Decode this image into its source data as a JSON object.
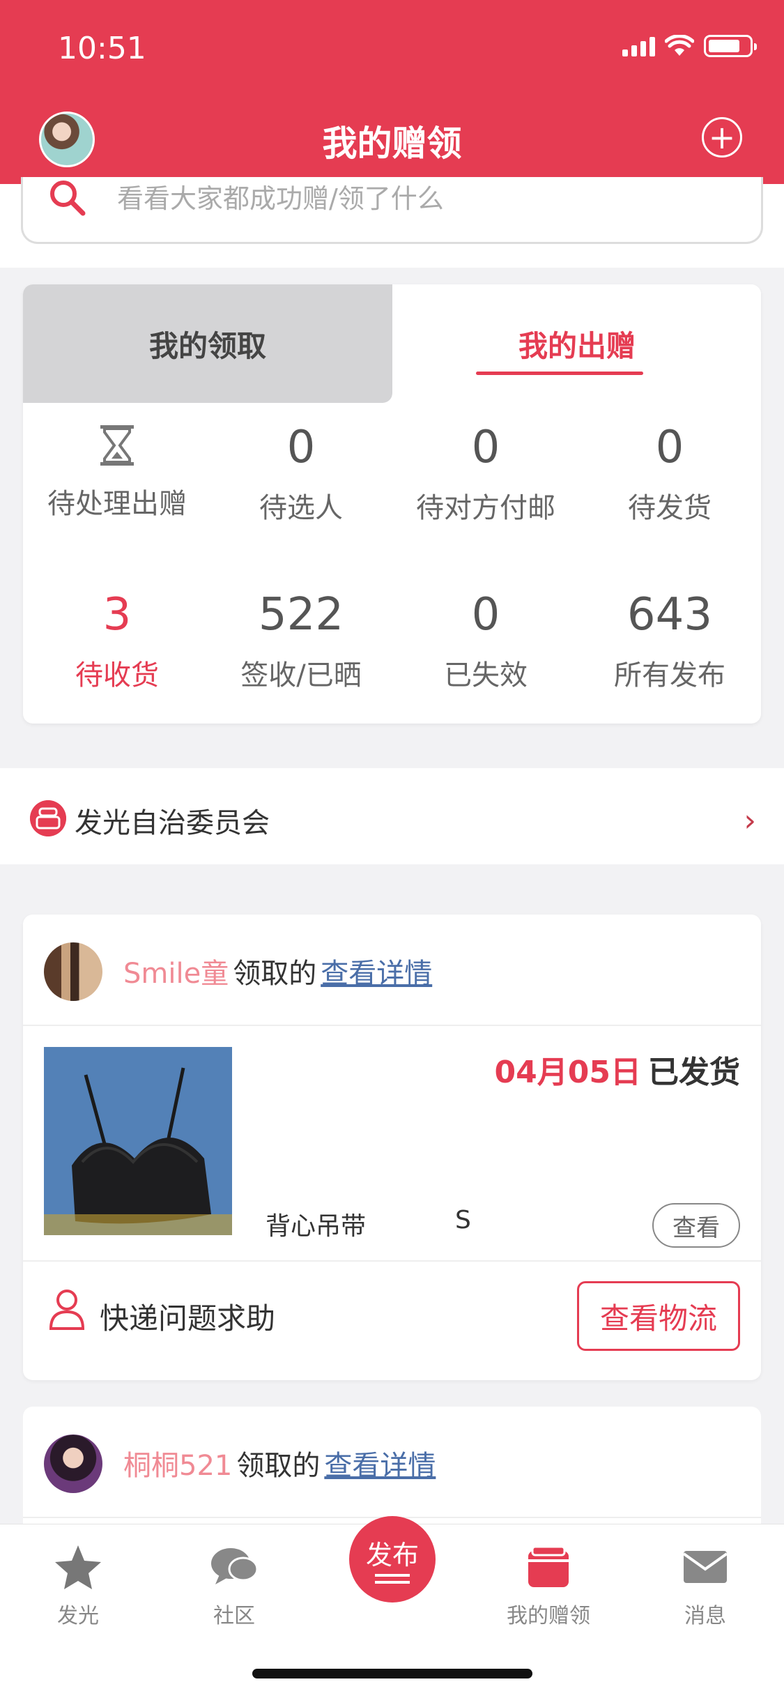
{
  "status_bar": {
    "time": "10:51"
  },
  "header": {
    "title": "我的赠领",
    "add_icon": "plus-circle-icon"
  },
  "search": {
    "placeholder": "看看大家都成功赠/领了什么"
  },
  "tabs": {
    "left": "我的领取",
    "right": "我的出赠"
  },
  "stats": {
    "row1": [
      {
        "value": "",
        "label": "待处理出赠",
        "icon": "hourglass-icon"
      },
      {
        "value": "0",
        "label": "待选人"
      },
      {
        "value": "0",
        "label": "待对方付邮"
      },
      {
        "value": "0",
        "label": "待发货"
      }
    ],
    "row2": [
      {
        "value": "3",
        "label": "待收货"
      },
      {
        "value": "522",
        "label": "签收/已晒"
      },
      {
        "value": "0",
        "label": "已失效"
      },
      {
        "value": "643",
        "label": "所有发布"
      }
    ]
  },
  "committee": {
    "label": "发光自治委员会"
  },
  "orders": [
    {
      "user": "Smile童",
      "action": "领取的",
      "link": "查看详情",
      "date": "04月05日",
      "status": "已发货",
      "product_name": "背心吊带",
      "product_size": "S",
      "view": "查看",
      "help": "快递问题求助",
      "logistics": "查看物流"
    },
    {
      "user": "桐桐521",
      "action": "领取的",
      "link": "查看详情"
    }
  ],
  "tabbar": {
    "items": [
      {
        "label": "发光",
        "icon": "star-icon"
      },
      {
        "label": "社区",
        "icon": "chat-bubbles-icon"
      },
      {
        "label": "发布",
        "icon": "publish-icon"
      },
      {
        "label": "我的赠领",
        "icon": "gift-box-icon"
      },
      {
        "label": "消息",
        "icon": "envelope-icon"
      }
    ]
  },
  "colors": {
    "brand": "#e53c52",
    "link": "#4a6ea8",
    "username": "#f08a94"
  }
}
